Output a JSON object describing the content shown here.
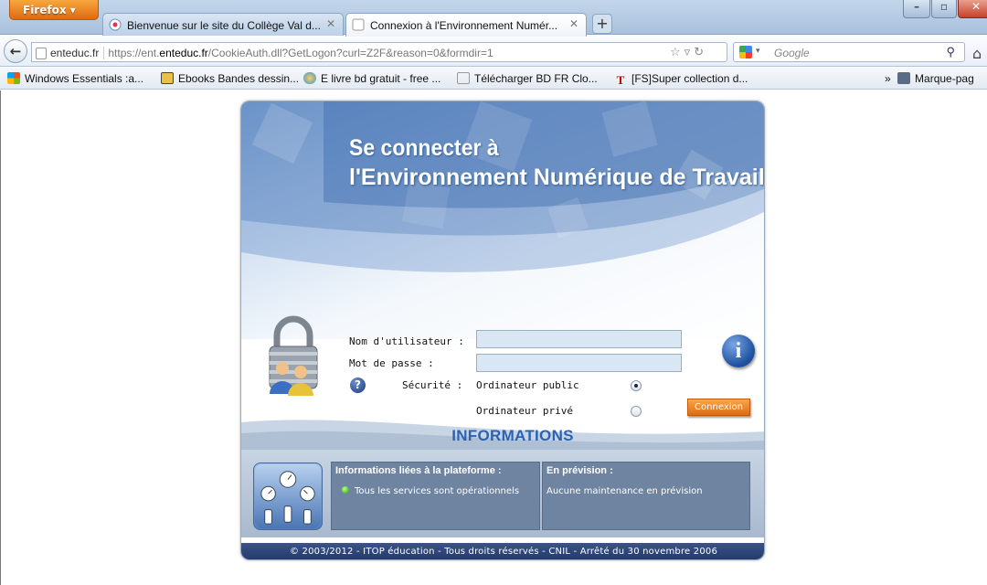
{
  "browser": {
    "app_button": "Firefox",
    "tabs": [
      {
        "label": "Bienvenue sur le site du Collège Val d..."
      },
      {
        "label": "Connexion à l'Environnement Numér..."
      }
    ],
    "new_tab": "+",
    "url": {
      "site": "enteduc.fr",
      "prefix": "https://ent.",
      "host": "enteduc.fr",
      "path": "/CookieAuth.dll?GetLogon?curl=Z2F&reason=0&formdir=1"
    },
    "search_placeholder": "Google",
    "bookmarks": [
      "Windows Essentials :a...",
      "Ebooks Bandes dessin...",
      "E livre bd gratuit - free ...",
      "Télécharger BD FR Clo...",
      "[FS]Super collection d..."
    ],
    "bookmarks_more": "»",
    "bookmarks_menu": "Marque-pag"
  },
  "login": {
    "title_line1": "Se connecter à",
    "title_line2": "l'Environnement Numérique de Travail",
    "username_label": "Nom d'utilisateur :",
    "username_value": "",
    "password_label": "Mot de passe :",
    "password_value": "",
    "security_label": "Sécurité :",
    "options": [
      {
        "label": "Ordinateur public",
        "selected": true
      },
      {
        "label": "Ordinateur privé",
        "selected": false
      }
    ],
    "submit": "Connexion"
  },
  "info": {
    "heading": "INFORMATIONS",
    "platform_title": "Informations liées à la plateforme :",
    "platform_status": "Tous les services sont opérationnels",
    "forecast_title": "En prévision :",
    "forecast_text": "Aucune maintenance en prévision"
  },
  "footer": "© 2003/2012 - ITOP éducation - Tous droits réservés - CNIL - Arrêté du 30 novembre 2006"
}
